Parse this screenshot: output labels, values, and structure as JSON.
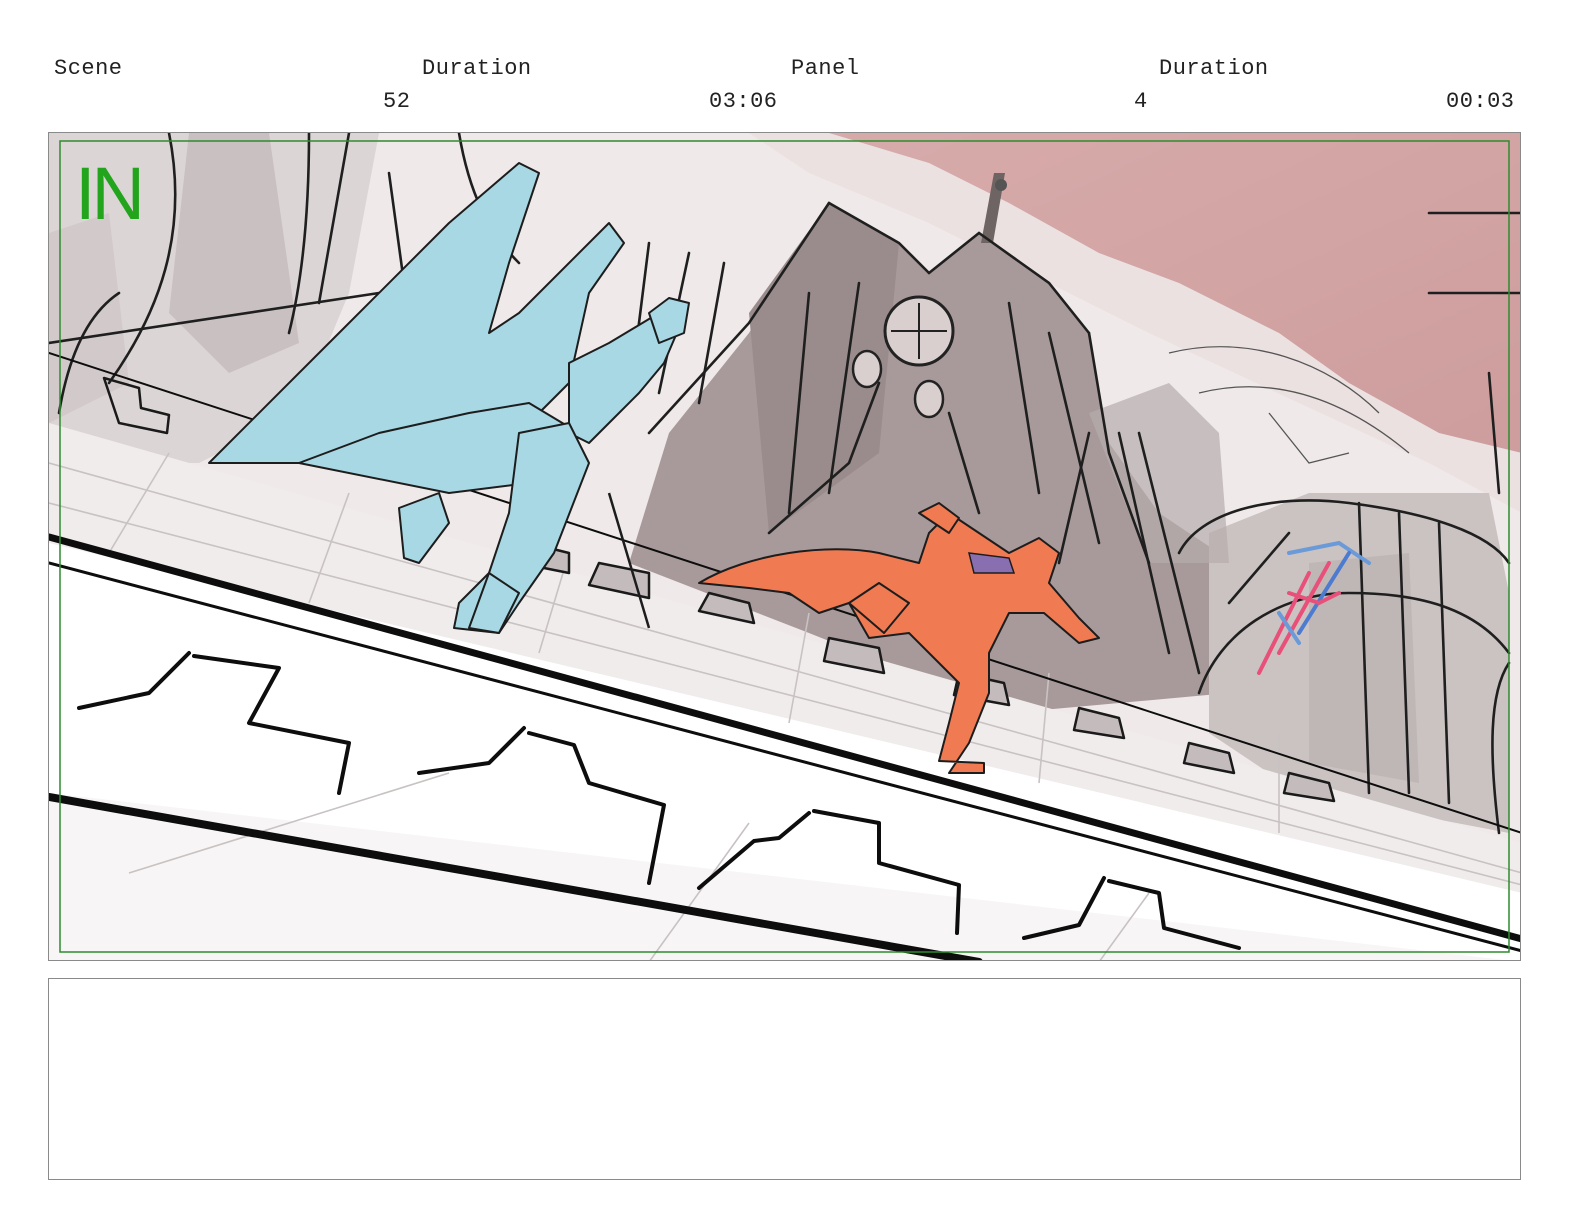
{
  "header": {
    "scene_label": "Scene",
    "scene_duration_label": "Duration",
    "panel_label": "Panel",
    "panel_duration_label": "Duration",
    "scene_value": "52",
    "scene_duration_value": "03:06",
    "panel_value": "4",
    "panel_duration_value": "00:03"
  },
  "panel": {
    "transition_label": "IN",
    "transition_color": "#22a51c",
    "safe_frame_color": "#2e8b2e",
    "sky_color": "#c47e7e",
    "character_left_color": "#a8d8e4",
    "character_right_color": "#f07a52",
    "character_far_color": "#e8507a"
  },
  "notes": {
    "text": ""
  }
}
